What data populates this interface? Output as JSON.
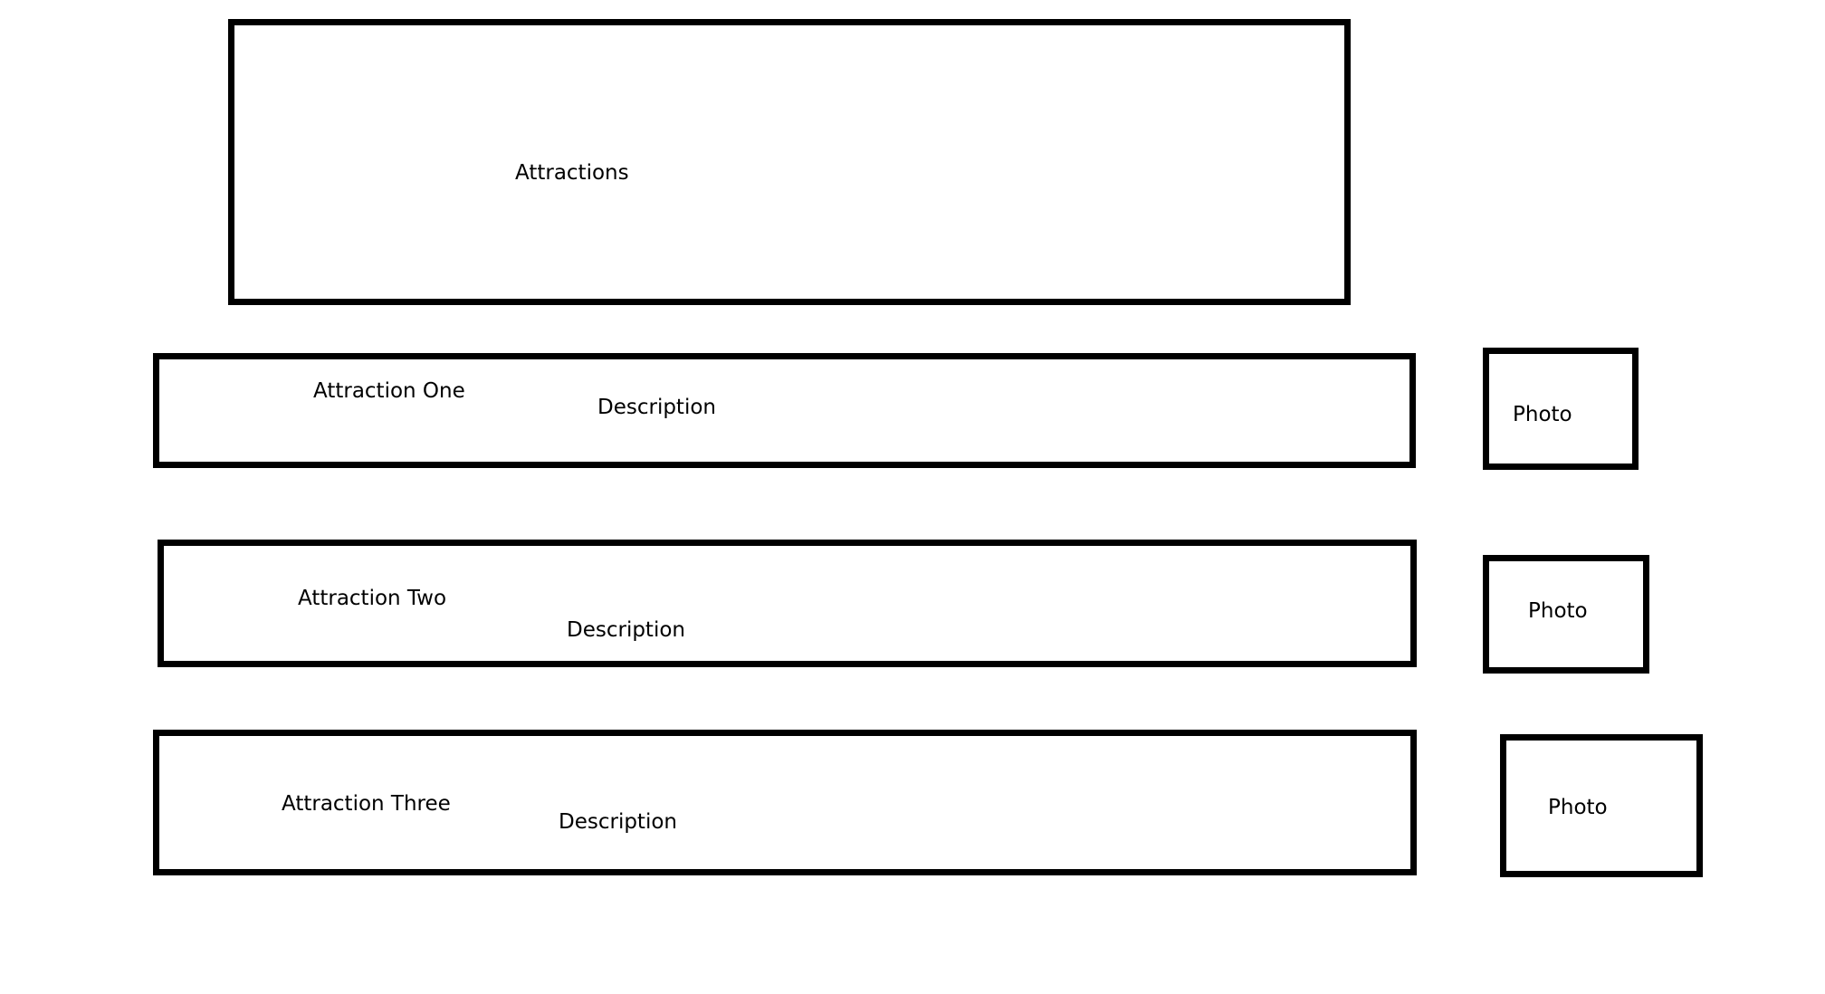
{
  "header": {
    "title": "Attractions"
  },
  "attractions": [
    {
      "name": "Attraction One",
      "description": "Description",
      "photo": "Photo"
    },
    {
      "name": "Attraction Two",
      "description": "Description",
      "photo": "Photo"
    },
    {
      "name": "Attraction Three",
      "description": "Description",
      "photo": "Photo"
    }
  ]
}
